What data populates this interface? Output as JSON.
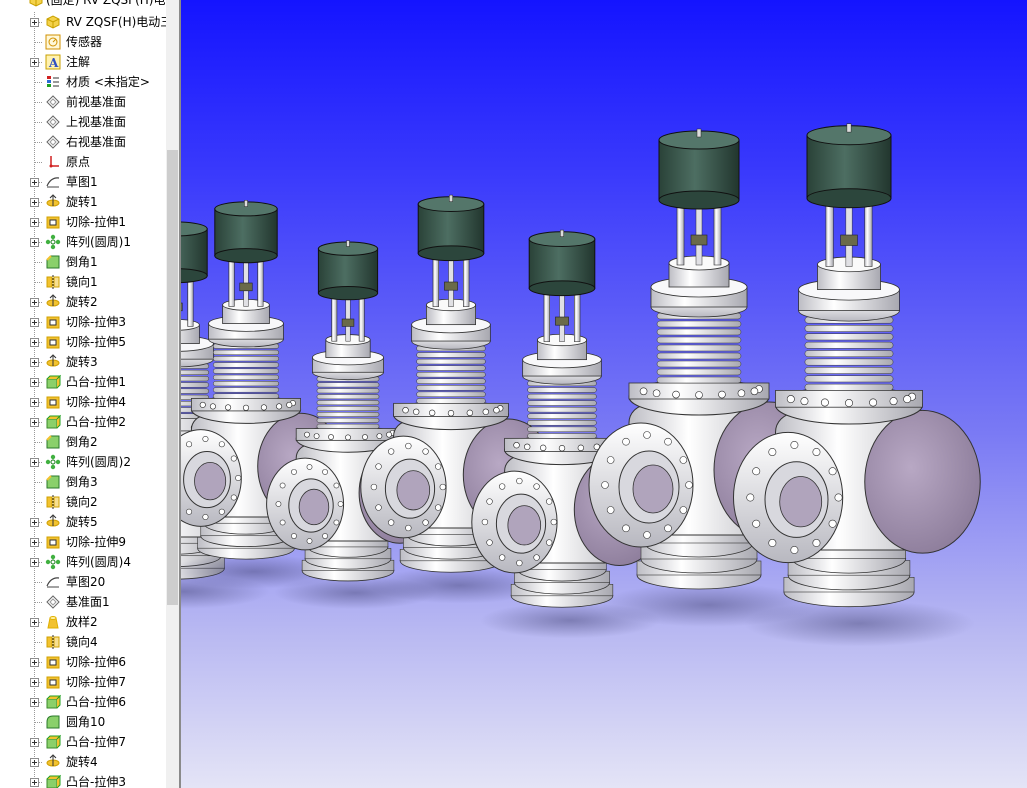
{
  "window": {
    "root_label": "(固定) RV ZQSF(H)电动三"
  },
  "feature_tree": {
    "items": [
      {
        "label": "RV ZQSF(H)电动三",
        "icon": "part-icon",
        "color": "#c8a000",
        "expand": true
      },
      {
        "label": "传感器",
        "icon": "sensor-icon",
        "color": "#d09000",
        "expand": false
      },
      {
        "label": "注解",
        "icon": "annotation-icon",
        "color": "#c8a000",
        "expand": true
      },
      {
        "label": "材质 <未指定>",
        "icon": "material-icon",
        "color": "#2b6cd6",
        "expand": false
      },
      {
        "label": "前视基准面",
        "icon": "plane-icon",
        "color": "#777777",
        "expand": false
      },
      {
        "label": "上视基准面",
        "icon": "plane-icon",
        "color": "#777777",
        "expand": false
      },
      {
        "label": "右视基准面",
        "icon": "plane-icon",
        "color": "#777777",
        "expand": false
      },
      {
        "label": "原点",
        "icon": "origin-icon",
        "color": "#d02020",
        "expand": false
      },
      {
        "label": "草图1",
        "icon": "sketch-icon",
        "color": "#555555",
        "expand": true
      },
      {
        "label": "旋转1",
        "icon": "revolve-icon",
        "color": "#d0a000",
        "expand": true
      },
      {
        "label": "切除-拉伸1",
        "icon": "cut-extrude-icon",
        "color": "#d0a000",
        "expand": true
      },
      {
        "label": "阵列(圆周)1",
        "icon": "circular-pattern-icon",
        "color": "#20a020",
        "expand": true
      },
      {
        "label": "倒角1",
        "icon": "chamfer-icon",
        "color": "#20a020",
        "expand": false
      },
      {
        "label": "镜向1",
        "icon": "mirror-icon",
        "color": "#d0a000",
        "expand": false
      },
      {
        "label": "旋转2",
        "icon": "revolve-icon",
        "color": "#d0a000",
        "expand": true
      },
      {
        "label": "切除-拉伸3",
        "icon": "cut-extrude-icon",
        "color": "#d0a000",
        "expand": true
      },
      {
        "label": "切除-拉伸5",
        "icon": "cut-extrude-icon",
        "color": "#d0a000",
        "expand": true
      },
      {
        "label": "旋转3",
        "icon": "revolve-icon",
        "color": "#d0a000",
        "expand": true
      },
      {
        "label": "凸台-拉伸1",
        "icon": "boss-extrude-icon",
        "color": "#20a020",
        "expand": true
      },
      {
        "label": "切除-拉伸4",
        "icon": "cut-extrude-icon",
        "color": "#d0a000",
        "expand": true
      },
      {
        "label": "凸台-拉伸2",
        "icon": "boss-extrude-icon",
        "color": "#20a020",
        "expand": true
      },
      {
        "label": "倒角2",
        "icon": "chamfer-icon",
        "color": "#20a020",
        "expand": false
      },
      {
        "label": "阵列(圆周)2",
        "icon": "circular-pattern-icon",
        "color": "#20a020",
        "expand": true
      },
      {
        "label": "倒角3",
        "icon": "chamfer-icon",
        "color": "#20a020",
        "expand": false
      },
      {
        "label": "镜向2",
        "icon": "mirror-icon",
        "color": "#d0a000",
        "expand": false
      },
      {
        "label": "旋转5",
        "icon": "revolve-icon",
        "color": "#d0a000",
        "expand": true
      },
      {
        "label": "切除-拉伸9",
        "icon": "cut-extrude-icon",
        "color": "#d0a000",
        "expand": true
      },
      {
        "label": "阵列(圆周)4",
        "icon": "circular-pattern-icon",
        "color": "#20a020",
        "expand": true
      },
      {
        "label": "草图20",
        "icon": "sketch-icon",
        "color": "#555555",
        "expand": false
      },
      {
        "label": "基准面1",
        "icon": "plane-icon",
        "color": "#777777",
        "expand": false
      },
      {
        "label": "放样2",
        "icon": "loft-icon",
        "color": "#e0b000",
        "expand": true
      },
      {
        "label": "镜向4",
        "icon": "mirror-icon",
        "color": "#d0a000",
        "expand": false
      },
      {
        "label": "切除-拉伸6",
        "icon": "cut-extrude-icon",
        "color": "#d0a000",
        "expand": true
      },
      {
        "label": "切除-拉伸7",
        "icon": "cut-extrude-icon",
        "color": "#d0a000",
        "expand": true
      },
      {
        "label": "凸台-拉伸6",
        "icon": "boss-extrude-icon",
        "color": "#20a020",
        "expand": true
      },
      {
        "label": "圆角10",
        "icon": "fillet-icon",
        "color": "#20a020",
        "expand": false
      },
      {
        "label": "凸台-拉伸7",
        "icon": "boss-extrude-icon",
        "color": "#20a020",
        "expand": true
      },
      {
        "label": "旋转4",
        "icon": "revolve-icon",
        "color": "#d0a000",
        "expand": true
      },
      {
        "label": "凸台-拉伸3",
        "icon": "boss-extrude-icon",
        "color": "#20a020",
        "expand": true
      }
    ]
  },
  "viewport": {
    "model_name": "electric-three-way-valve",
    "colors": {
      "flange": "#f0f0f0",
      "cover": "#9a8aa8",
      "actuator": "#3c5a50",
      "bg_top": "#1414ff",
      "bg_bottom": "#e4e4f6"
    }
  }
}
